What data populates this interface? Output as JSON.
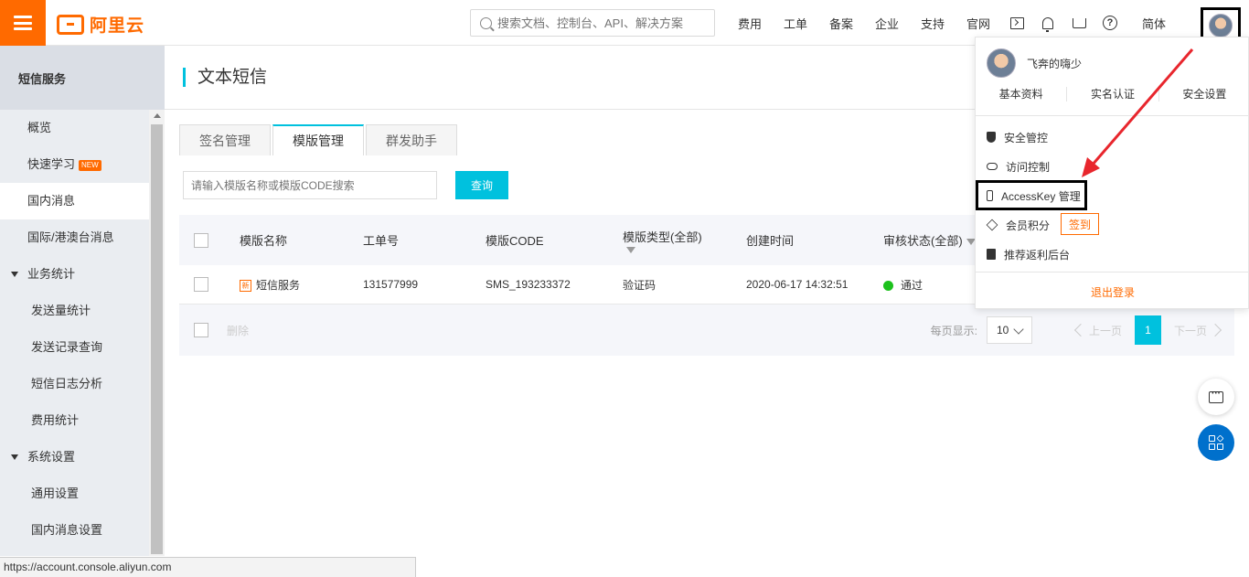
{
  "topbar": {
    "brand": "阿里云",
    "search_placeholder": "搜索文档、控制台、API、解决方案",
    "nav": [
      "费用",
      "工单",
      "备案",
      "企业",
      "支持",
      "官网"
    ],
    "lang": "简体"
  },
  "sidebar": {
    "title": "短信服务",
    "items": [
      {
        "label": "概览"
      },
      {
        "label": "快速学习",
        "badge": "NEW"
      },
      {
        "label": "国内消息",
        "active": true
      },
      {
        "label": "国际/港澳台消息"
      }
    ],
    "group_stats": {
      "label": "业务统计",
      "items": [
        "发送量统计",
        "发送记录查询",
        "短信日志分析",
        "费用统计"
      ]
    },
    "group_settings": {
      "label": "系统设置",
      "items": [
        "通用设置",
        "国内消息设置"
      ]
    }
  },
  "page": {
    "title": "文本短信"
  },
  "tabs": [
    "签名管理",
    "模版管理",
    "群发助手"
  ],
  "filter": {
    "placeholder": "请输入模版名称或模版CODE搜索",
    "query_label": "查询"
  },
  "table": {
    "headers": [
      "模版名称",
      "工单号",
      "模版CODE",
      "模版类型(全部)",
      "创建时间",
      "审核状态(全部)"
    ],
    "rows": [
      {
        "name": "短信服务",
        "name_icon": "新",
        "ticket": "131577999",
        "code": "SMS_193233372",
        "type": "验证码",
        "created": "2020-06-17 14:32:51",
        "status": "通过"
      }
    ],
    "footer": {
      "delete_label": "删除",
      "page_size_label": "每页显示:",
      "page_size": "10",
      "prev": "上一页",
      "current_page": "1",
      "next": "下一页"
    }
  },
  "dropdown": {
    "username": "飞奔的嗨少",
    "links": [
      "基本资料",
      "实名认证",
      "安全设置"
    ],
    "items": [
      "安全管控",
      "访问控制",
      "AccessKey 管理",
      "会员积分",
      "推荐返利后台"
    ],
    "sign_in": "签到",
    "logout": "退出登录"
  },
  "status_url": "https://account.console.aliyun.com",
  "colors": {
    "brand": "#ff6a00",
    "accent": "#00c1de",
    "annotation_arrow": "#e8262d",
    "status_ok": "#1dc11d"
  }
}
